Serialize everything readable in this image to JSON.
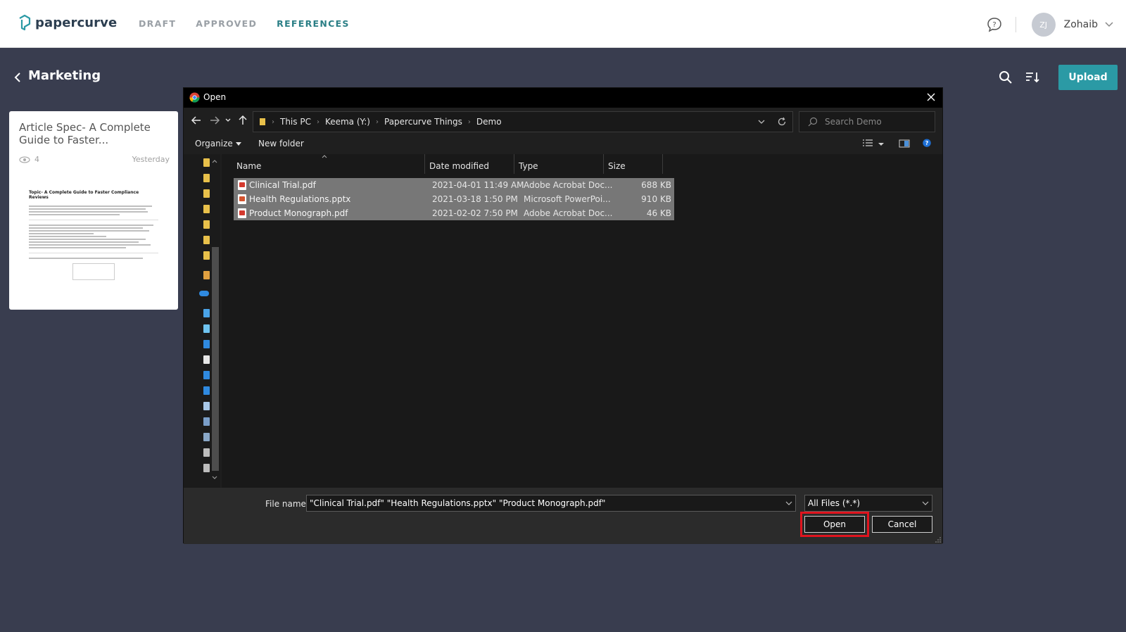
{
  "app": {
    "logo_text": "papercurve",
    "nav": [
      "DRAFT",
      "APPROVED",
      "REFERENCES"
    ],
    "active_nav": "REFERENCES",
    "user": {
      "initials": "ZJ",
      "name": "Zohaib"
    }
  },
  "page": {
    "title": "Marketing",
    "upload_label": "Upload"
  },
  "card": {
    "title": "Article Spec- A Complete Guide to Faster...",
    "views": "4",
    "date": "Yesterday",
    "preview_heading": "Topic- A Complete Guide to Faster Compliance Reviews"
  },
  "dialog": {
    "title": "Open",
    "breadcrumbs": [
      "This PC",
      "Keema (Y:)",
      "Papercurve Things",
      "Demo"
    ],
    "search_placeholder": "Search Demo",
    "commands": {
      "organize": "Organize",
      "new_folder": "New folder"
    },
    "columns": {
      "name": "Name",
      "date": "Date modified",
      "type": "Type",
      "size": "Size"
    },
    "files": [
      {
        "name": "Clinical Trial.pdf",
        "date": "2021-04-01 11:49 AM",
        "type": "Adobe Acrobat Doc...",
        "size": "688 KB"
      },
      {
        "name": "Health Regulations.pptx",
        "date": "2021-03-18 1:50 PM",
        "type": "Microsoft PowerPoi...",
        "size": "910 KB"
      },
      {
        "name": "Product Monograph.pdf",
        "date": "2021-02-02 7:50 PM",
        "type": "Adobe Acrobat Doc...",
        "size": "46 KB"
      }
    ],
    "file_name_label": "File name:",
    "file_name_value": "\"Clinical Trial.pdf\" \"Health Regulations.pptx\" \"Product Monograph.pdf\"",
    "file_type": "All Files (*.*)",
    "open_label": "Open",
    "cancel_label": "Cancel"
  },
  "colors": {
    "page_bg": "#393d4f",
    "accent": "#2b9aa5",
    "nav_active": "#2b7f86",
    "selected_row": "#777777",
    "highlight": "#e0141e"
  }
}
